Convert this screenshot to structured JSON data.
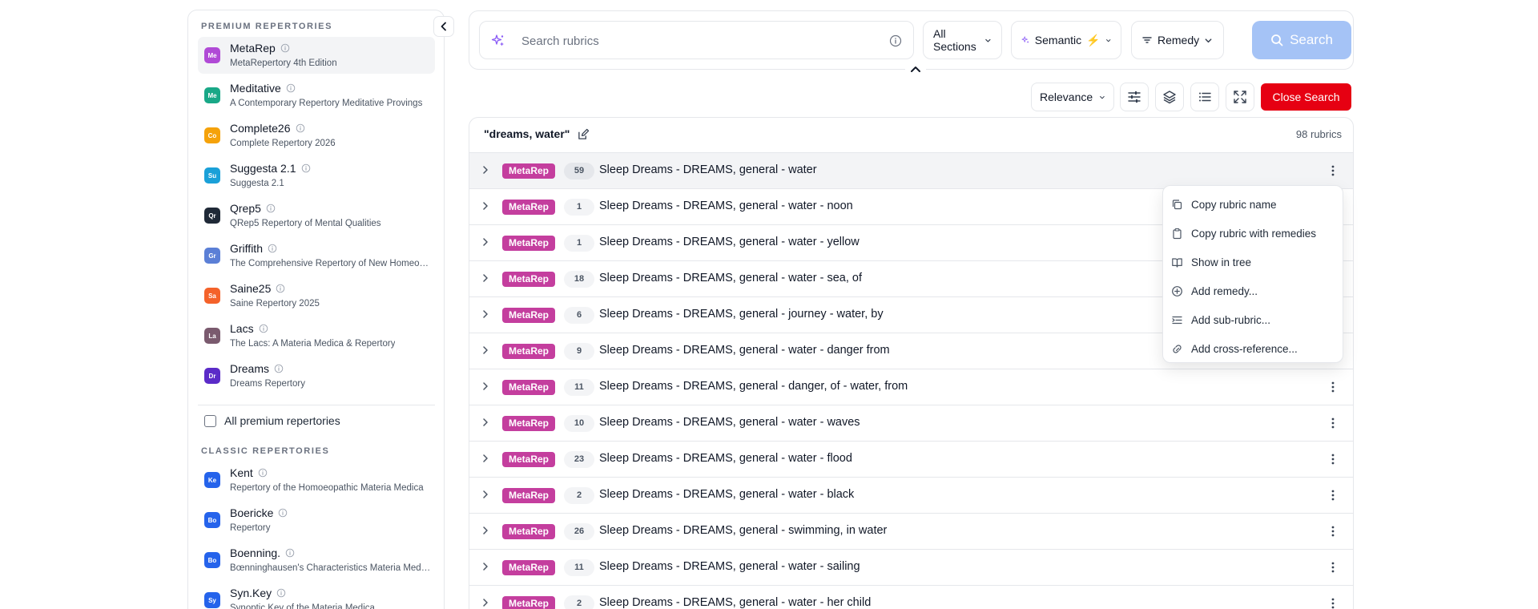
{
  "sidebar": {
    "premium_title": "PREMIUM REPERTORIES",
    "premium": [
      {
        "abbr": "Me",
        "name": "MetaRep",
        "sub": "MetaRepertory 4th Edition",
        "color": "#b04ad6",
        "active": true
      },
      {
        "abbr": "Me",
        "name": "Meditative",
        "sub": "A Contemporary Repertory Meditative Provings",
        "color": "#19a887"
      },
      {
        "abbr": "Co",
        "name": "Complete26",
        "sub": "Complete Repertory 2026",
        "color": "#f5a20a"
      },
      {
        "abbr": "Su",
        "name": "Suggesta 2.1",
        "sub": "Suggesta 2.1",
        "color": "#1aa0d8"
      },
      {
        "abbr": "Qr",
        "name": "Qrep5",
        "sub": "QRep5 Repertory of Mental Qualities",
        "color": "#1f2937"
      },
      {
        "abbr": "Gr",
        "name": "Griffith",
        "sub": "The Comprehensive Repertory of New Homeopathic Provings",
        "color": "#5b7fd6"
      },
      {
        "abbr": "Sa",
        "name": "Saine25",
        "sub": "Saine Repertory 2025",
        "color": "#f4622a"
      },
      {
        "abbr": "La",
        "name": "Lacs",
        "sub": "The Lacs: A Materia Medica & Repertory",
        "color": "#7a5a6e"
      },
      {
        "abbr": "Dr",
        "name": "Dreams",
        "sub": "Dreams Repertory",
        "color": "#5b2bc8"
      }
    ],
    "all_premium_label": "All premium repertories",
    "classic_title": "CLASSIC REPERTORIES",
    "classic": [
      {
        "abbr": "Ke",
        "name": "Kent",
        "sub": "Repertory of the Homoeopathic Materia Medica",
        "color": "#2563eb"
      },
      {
        "abbr": "Bo",
        "name": "Boericke",
        "sub": "Repertory",
        "color": "#2563eb"
      },
      {
        "abbr": "Bo",
        "name": "Boenning.",
        "sub": "Bœnninghausen's Characteristics Materia Medica",
        "color": "#2563eb"
      },
      {
        "abbr": "Sy",
        "name": "Syn.Key",
        "sub": "Synoptic Key of the Materia Medica",
        "color": "#2563eb"
      }
    ]
  },
  "search": {
    "placeholder": "Search rubrics",
    "sections_label": "All Sections",
    "mode_label": "Semantic",
    "mode_emoji": "⚡",
    "remedy_label": "Remedy",
    "button_label": "Search"
  },
  "toolbar": {
    "sort_label": "Relevance",
    "close_label": "Close Search"
  },
  "results": {
    "query": "\"dreams, water\"",
    "count": "98 rubrics",
    "rows": [
      {
        "source": "MetaRep",
        "count": "59",
        "rubric": "Sleep Dreams - DREAMS, general - water",
        "highlight": true
      },
      {
        "source": "MetaRep",
        "count": "1",
        "rubric": "Sleep Dreams - DREAMS, general - water - noon"
      },
      {
        "source": "MetaRep",
        "count": "1",
        "rubric": "Sleep Dreams - DREAMS, general - water - yellow"
      },
      {
        "source": "MetaRep",
        "count": "18",
        "rubric": "Sleep Dreams - DREAMS, general - water - sea, of"
      },
      {
        "source": "MetaRep",
        "count": "6",
        "rubric": "Sleep Dreams - DREAMS, general - journey - water, by"
      },
      {
        "source": "MetaRep",
        "count": "9",
        "rubric": "Sleep Dreams - DREAMS, general - water - danger from"
      },
      {
        "source": "MetaRep",
        "count": "11",
        "rubric": "Sleep Dreams - DREAMS, general - danger, of - water, from"
      },
      {
        "source": "MetaRep",
        "count": "10",
        "rubric": "Sleep Dreams - DREAMS, general - water - waves"
      },
      {
        "source": "MetaRep",
        "count": "23",
        "rubric": "Sleep Dreams - DREAMS, general - water - flood"
      },
      {
        "source": "MetaRep",
        "count": "2",
        "rubric": "Sleep Dreams - DREAMS, general - water - black"
      },
      {
        "source": "MetaRep",
        "count": "26",
        "rubric": "Sleep Dreams - DREAMS, general - swimming, in water"
      },
      {
        "source": "MetaRep",
        "count": "11",
        "rubric": "Sleep Dreams - DREAMS, general - water - sailing"
      },
      {
        "source": "MetaRep",
        "count": "2",
        "rubric": "Sleep Dreams - DREAMS, general - water - her child"
      }
    ]
  },
  "context_menu": {
    "items": [
      {
        "icon": "copy-icon",
        "label": "Copy rubric name"
      },
      {
        "icon": "clipboard-icon",
        "label": "Copy rubric with remedies"
      },
      {
        "icon": "book-icon",
        "label": "Show in tree"
      },
      {
        "icon": "plus-circle-icon",
        "label": "Add remedy..."
      },
      {
        "icon": "indent-icon",
        "label": "Add sub-rubric..."
      },
      {
        "icon": "link-icon",
        "label": "Add cross-reference..."
      }
    ]
  }
}
